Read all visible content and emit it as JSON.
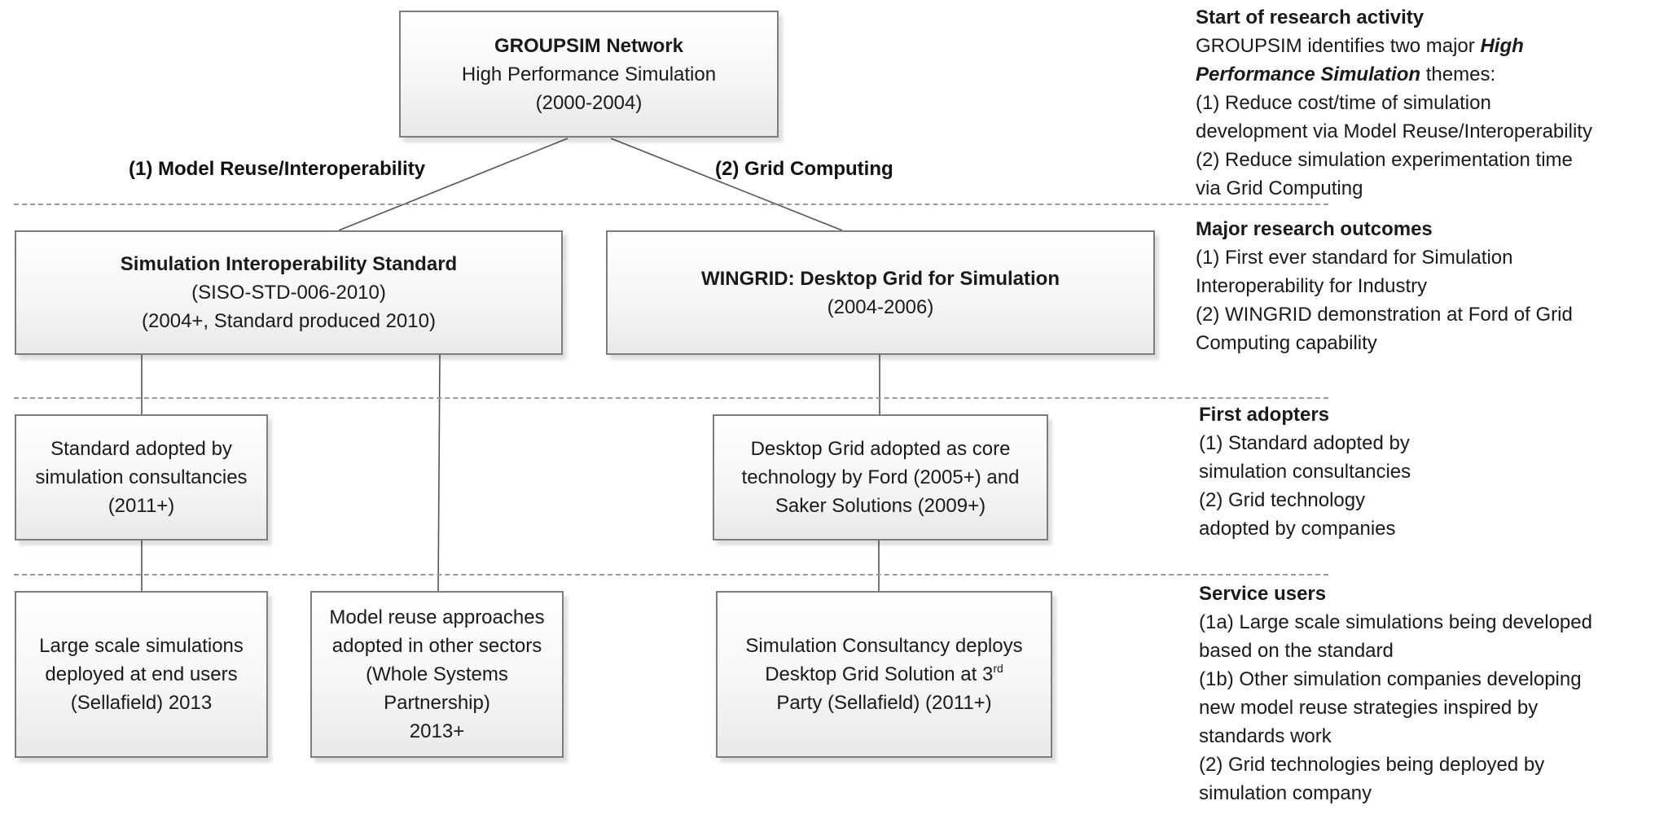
{
  "diagram": {
    "root": {
      "title": "GROUPSIM Network",
      "subtitle": "High Performance Simulation",
      "period": "(2000-2004)"
    },
    "edge_labels": {
      "left": "(1) Model Reuse/Interoperability",
      "right": "(2) Grid Computing"
    },
    "level2": {
      "sis": {
        "title": "Simulation Interoperability Standard",
        "line2": "(SISO-STD-006-2010)",
        "line3": "(2004+, Standard produced 2010)"
      },
      "wingrid": {
        "title": "WINGRID: Desktop Grid for Simulation",
        "line2": "(2004-2006)"
      }
    },
    "level3": {
      "standard_adopted": {
        "line1": "Standard adopted by",
        "line2": "simulation consultancies",
        "line3": "(2011+)"
      },
      "desktop_grid_adopted": {
        "line1": "Desktop Grid adopted as core",
        "line2": "technology by Ford (2005+) and",
        "line3": "Saker Solutions (2009+)"
      }
    },
    "level4": {
      "large_scale": {
        "line1": "Large scale simulations",
        "line2": "deployed at end users",
        "line3": "(Sellafield) 2013"
      },
      "model_reuse": {
        "line1": "Model reuse approaches",
        "line2": "adopted in other sectors",
        "line3": "(Whole Systems",
        "line4": "Partnership)",
        "line5": "2013+"
      },
      "consultancy": {
        "line1": "Simulation Consultancy deploys",
        "line2a": "Desktop Grid Solution at 3",
        "line2sup": "rd",
        "line3": "Party (Sellafield) (2011+)"
      }
    }
  },
  "side_notes": {
    "start": {
      "heading": "Start of research activity",
      "l1a": "GROUPSIM identifies two major ",
      "l1b": "High",
      "l2a": "Performance Simulation",
      "l2b": " themes:",
      "l3": "(1) Reduce cost/time of simulation",
      "l4": "development via Model Reuse/Interoperability",
      "l5": "(2) Reduce simulation experimentation time",
      "l6": "via Grid Computing"
    },
    "outcomes": {
      "heading": "Major research outcomes",
      "l1": "(1) First ever standard for Simulation",
      "l2": "Interoperability for Industry",
      "l3": "(2) WINGRID demonstration at Ford of Grid",
      "l4": "Computing capability"
    },
    "adopters": {
      "heading": "First adopters",
      "l1": "(1) Standard adopted by",
      "l2": "simulation consultancies",
      "l3": "(2) Grid technology",
      "l4": "adopted by companies"
    },
    "service": {
      "heading": "Service users",
      "l1": "(1a) Large scale simulations being developed",
      "l2": "based on the standard",
      "l3": "(1b) Other simulation companies developing",
      "l4": "new model reuse strategies inspired by",
      "l5": "standards work",
      "l6": "(2) Grid technologies being deployed by",
      "l7": "simulation company"
    }
  }
}
